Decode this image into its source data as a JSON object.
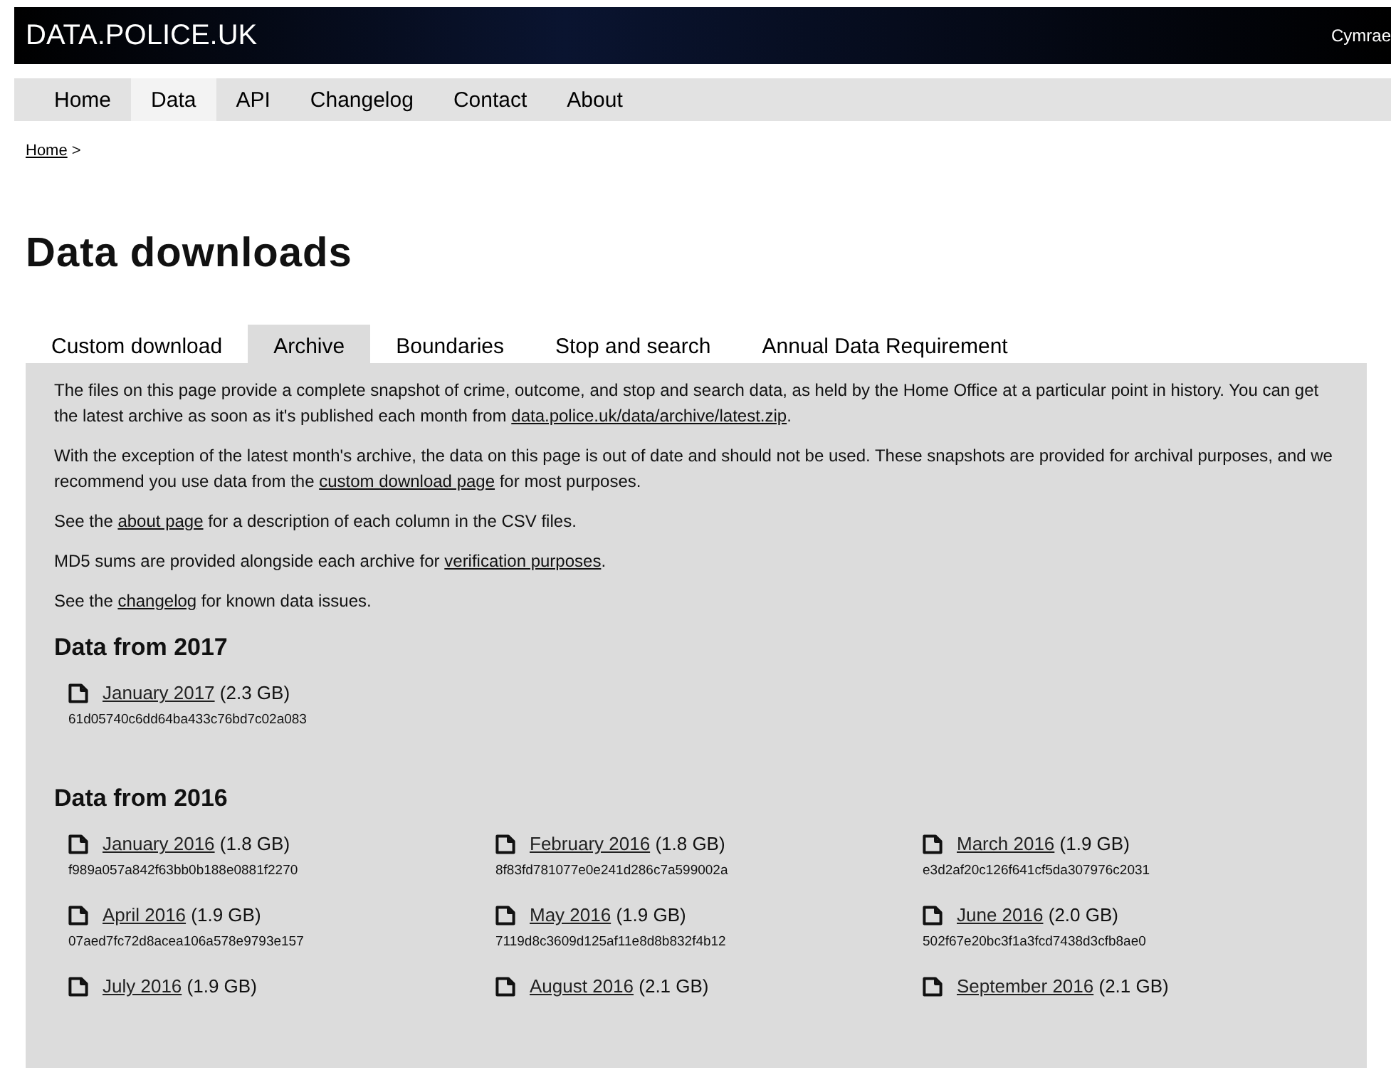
{
  "header": {
    "site_title": "DATA.POLICE.UK",
    "language_link": "Cymrae"
  },
  "nav": [
    {
      "label": "Home",
      "selected": false
    },
    {
      "label": "Data",
      "selected": true
    },
    {
      "label": "API",
      "selected": false
    },
    {
      "label": "Changelog",
      "selected": false
    },
    {
      "label": "Contact",
      "selected": false
    },
    {
      "label": "About",
      "selected": false
    }
  ],
  "breadcrumb": {
    "link": "Home",
    "separator": ">"
  },
  "page_title": "Data downloads",
  "tabs": [
    {
      "label": "Custom download",
      "selected": false
    },
    {
      "label": "Archive",
      "selected": true
    },
    {
      "label": "Boundaries",
      "selected": false
    },
    {
      "label": "Stop and search",
      "selected": false
    },
    {
      "label": "Annual Data Requirement",
      "selected": false
    }
  ],
  "paragraphs": [
    [
      {
        "kind": "text",
        "text": "The files on this page provide a complete snapshot of crime, outcome, and stop and search data, as held by the Home Office at a particular point in history. You can get the latest archive as soon as it's published each month from "
      },
      {
        "kind": "link",
        "text": "data.police.uk/data/archive/latest.zip"
      },
      {
        "kind": "text",
        "text": "."
      }
    ],
    [
      {
        "kind": "text",
        "text": "With the exception of the latest month's archive, the data on this page is out of date and should not be used. These snapshots are provided for archival purposes, and we recommend you use data from the "
      },
      {
        "kind": "link",
        "text": "custom download page"
      },
      {
        "kind": "text",
        "text": " for most purposes."
      }
    ],
    [
      {
        "kind": "text",
        "text": "See the "
      },
      {
        "kind": "link",
        "text": "about page"
      },
      {
        "kind": "text",
        "text": " for a description of each column in the CSV files."
      }
    ],
    [
      {
        "kind": "text",
        "text": "MD5 sums are provided alongside each archive for "
      },
      {
        "kind": "link",
        "text": "verification purposes"
      },
      {
        "kind": "text",
        "text": "."
      }
    ],
    [
      {
        "kind": "text",
        "text": "See the "
      },
      {
        "kind": "link",
        "text": "changelog"
      },
      {
        "kind": "text",
        "text": " for known data issues."
      }
    ]
  ],
  "sections": [
    {
      "heading": "Data from 2017",
      "files": [
        {
          "link": "January 2017",
          "size": "(2.3 GB)",
          "md5": "61d05740c6dd64ba433c76bd7c02a083"
        }
      ]
    },
    {
      "heading": "Data from 2016",
      "files": [
        {
          "link": "January 2016",
          "size": "(1.8 GB)",
          "md5": "f989a057a842f63bb0b188e0881f2270"
        },
        {
          "link": "February 2016",
          "size": "(1.8 GB)",
          "md5": "8f83fd781077e0e241d286c7a599002a"
        },
        {
          "link": "March 2016",
          "size": "(1.9 GB)",
          "md5": "e3d2af20c126f641cf5da307976c2031"
        },
        {
          "link": "April 2016",
          "size": "(1.9 GB)",
          "md5": "07aed7fc72d8acea106a578e9793e157"
        },
        {
          "link": "May 2016",
          "size": "(1.9 GB)",
          "md5": "7119d8c3609d125af11e8d8b832f4b12"
        },
        {
          "link": "June 2016",
          "size": "(2.0 GB)",
          "md5": "502f67e20bc3f1a3fcd7438d3cfb8ae0"
        },
        {
          "link": "July 2016",
          "size": "(1.9 GB)"
        },
        {
          "link": "August 2016",
          "size": "(2.1 GB)"
        },
        {
          "link": "September 2016",
          "size": "(2.1 GB)"
        }
      ]
    }
  ]
}
